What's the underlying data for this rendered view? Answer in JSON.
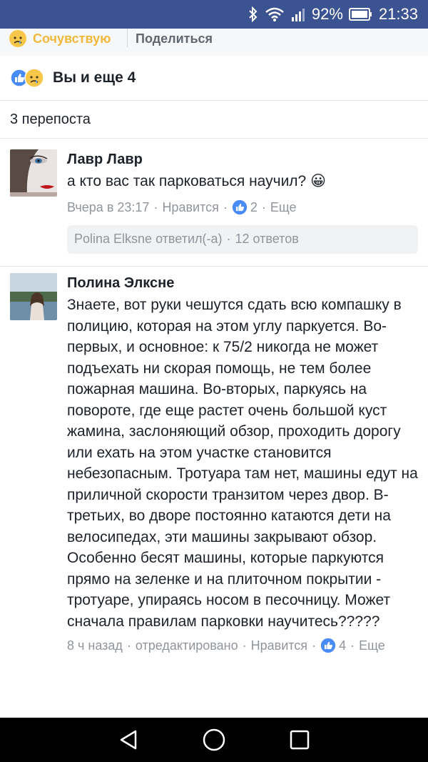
{
  "status_bar": {
    "battery_percent": "92%",
    "time": "21:33",
    "icons": [
      "bluetooth-icon",
      "wifi-icon",
      "signal-icon",
      "battery-icon"
    ],
    "background": "#3b5390"
  },
  "actions": {
    "sympathy_label": "Сочувствую",
    "share_label": "Поделиться"
  },
  "reactions": {
    "summary": "Вы и еще 4",
    "icons": [
      "like-icon",
      "sad-icon"
    ]
  },
  "reposts": {
    "label": "3 перепоста"
  },
  "comments": [
    {
      "author": "Лавр Лавр",
      "text": "а кто вас так парковаться научил? 😀",
      "time": "Вчера в 23:17",
      "like_label": "Нравится",
      "like_count": "2",
      "more_label": "Еще",
      "replies": {
        "author_line": "Polina Elksne ответил(-а)",
        "count_label": "12 ответов"
      }
    },
    {
      "author": "Полина Элксне",
      "text": "Знаете, вот руки чешутся сдать всю компашку в полицию, которая на этом углу паркуется. Во-первых, и основное: к 75/2 никогда не может подъехать ни скорая помощь, не тем более пожарная машина. Во-вторых, паркуясь на повороте, где еще растет очень большой куст жамина, заслоняющий обзор, проходить дорогу или ехать на этом участке становится небезопасным. Тротуара там нет, машины едут на приличной скорости транзитом через двор. В-третьих, во дворе постоянно катаются дети на велосипедах, эти машины закрывают обзор. Особенно бесят машины, которые паркуются прямо на зеленке и на плиточном покрытии - тротуаре, упираясь носом в песочницу. Может сначала правилам парковки научитесь?????",
      "time": "8 ч назад",
      "edited_label": "отредактировано",
      "like_label": "Нравится",
      "like_count": "4",
      "more_label": "Еще"
    }
  ],
  "nav": {
    "buttons": [
      "back-icon",
      "home-icon",
      "recents-icon"
    ]
  }
}
